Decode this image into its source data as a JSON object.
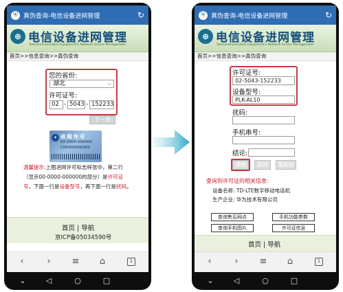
{
  "left": {
    "title": "真伪查询-电信设备进网管理",
    "banner_title": "电信设备进网管理",
    "banner_sub": "Telecommunication Equipment's Network Access Management",
    "breadcrumb": "首页>>信息查询>>真伪查询",
    "province_label": "您的省份:",
    "province_value": "湖北",
    "license_label": "许可证号:",
    "license_parts": [
      "02",
      "5043",
      "152233"
    ],
    "next_button": "下一步",
    "sample": {
      "line1": "进 网 许 可",
      "line2": "02-0000-000000",
      "line3": "CN0000000000"
    },
    "hint_prefix": "温馨提示:",
    "hint_text1": "上图进网许可标志样张中，第二行（显示00-0000-000000的部分）是",
    "hint_link1": "许可证号",
    "hint_text2": "，下面一行是",
    "hint_link2": "设备型号",
    "hint_text3": "，再下面一行是",
    "hint_link3": "扰码",
    "hint_end": "。",
    "footer_links": "首页  |  导航",
    "footer_icp": "京ICP备05034590号"
  },
  "right": {
    "title": "真伪查询-电信设备进网管理",
    "banner_title": "电信设备进网管理",
    "banner_sub": "Telecommunication Equipment's Network Access Management",
    "breadcrumb": "首页>>信息查询>>真伪查询",
    "license_label": "许可证号:",
    "license_value": "02-5043-152233",
    "model_label": "设备型号:",
    "model_value": "PLK-AL10",
    "scramble_label": "扰码:",
    "serial_label": "手机串号:",
    "result_label": "结论:",
    "buttons": {
      "query": "查询",
      "back": "返回",
      "reenter": "重新验证"
    },
    "result_header": "查询到许可证的相关信息:",
    "device_name": "设备名称:  TD-LTE数字移动电话机",
    "maker": "生产企业:  华为技术有限公司",
    "options": [
      "查询售后网点",
      "手机功能参数",
      "查询手机图片",
      "许可证信息"
    ],
    "footer_links": "首页  |  导航"
  }
}
